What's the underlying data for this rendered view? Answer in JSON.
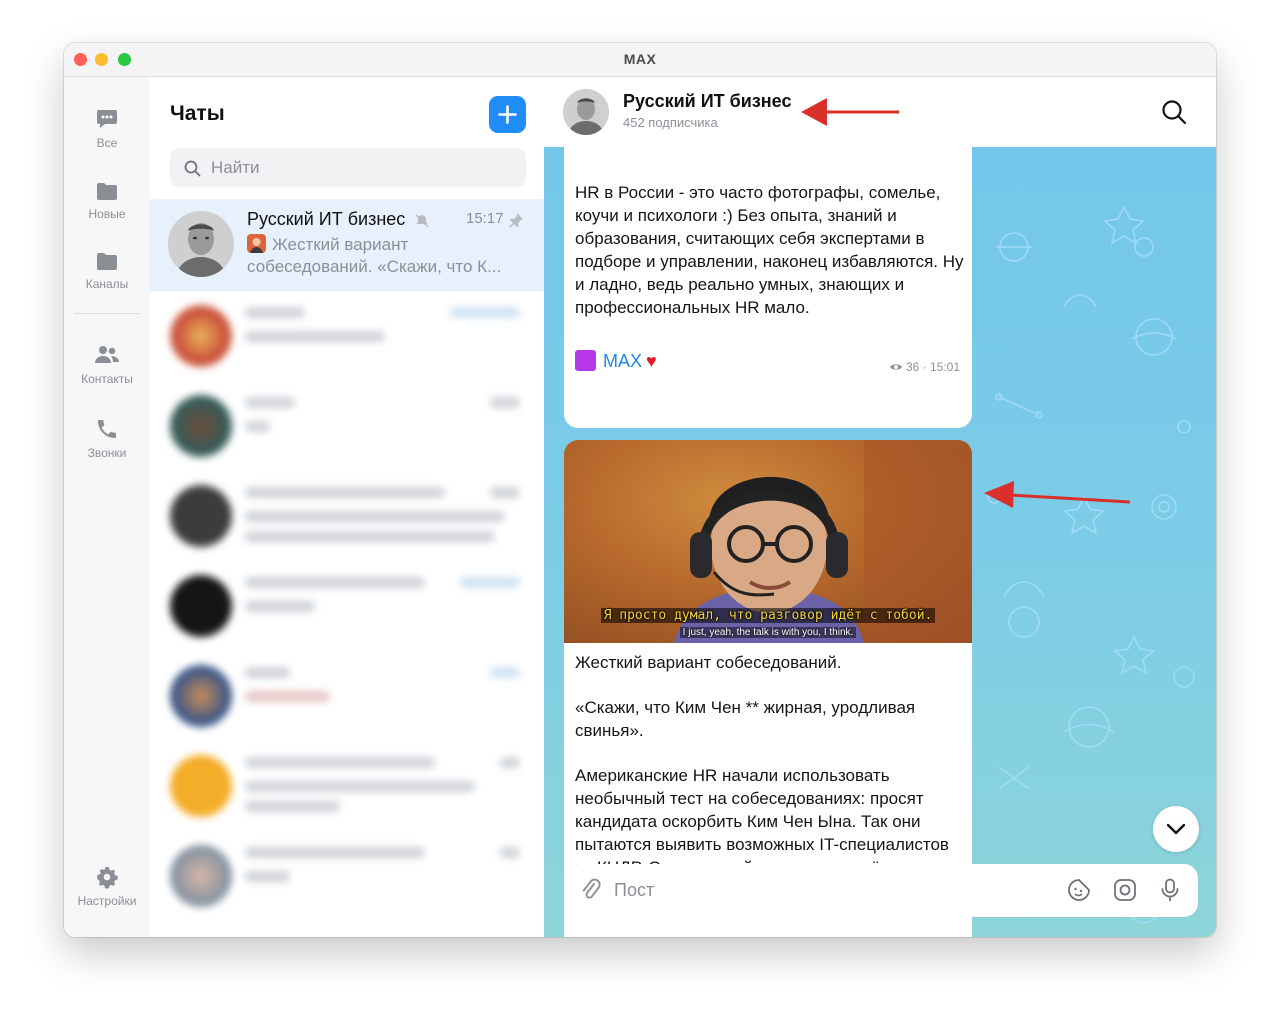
{
  "window": {
    "title": "MAX"
  },
  "rail": {
    "items": [
      {
        "label": "Все",
        "icon": "chat-bubble-icon"
      },
      {
        "label": "Новые",
        "icon": "folder-icon"
      },
      {
        "label": "Каналы",
        "icon": "folder-icon"
      },
      {
        "label": "Контакты",
        "icon": "people-icon"
      },
      {
        "label": "Звонки",
        "icon": "phone-icon"
      }
    ],
    "settings": {
      "label": "Настройки",
      "icon": "gear-icon"
    }
  },
  "chat_list": {
    "title": "Чаты",
    "new_chat_icon": "plus-icon",
    "search_placeholder": "Найти",
    "active_chat": {
      "name": "Русский ИТ бизнес",
      "time": "15:17",
      "preview_line1": "Жесткий вариант",
      "preview_line2": "собеседований.  «Скажи, что К..."
    }
  },
  "chat": {
    "header": {
      "name": "Русский ИТ бизнес",
      "subscribers": "452 подписчика"
    },
    "post1": {
      "text": "HR в России - это часто фотографы, сомелье, коучи и психологи :) Без опыта, знаний и образования, считающих себя экспертами в подборе и управлении, наконец избавляются. Ну и ладно, ведь реально умных, знающих и профессиональных HR мало.",
      "signature": "MAX",
      "views": "36",
      "time": "15:01"
    },
    "post2": {
      "video_subtitle_ru": "Я просто думал, что разговор идёт с тобой.",
      "video_subtitle_en": "I just, yeah, the talk is with you, I think.",
      "paragraph1": "Жесткий вариант собеседований.",
      "paragraph2": "«Скажи, что Ким Чен ** жирная, уродливая свинья».",
      "paragraph3": "Американские HR начали использовать необычный тест на собеседованиях: просят кандидата оскорбить Ким Чен Ына. Так они пытаются выявить возможных IT-специалистов из КНДР. Северокорейские хакеры всё чаще устраиваются в западные"
    },
    "composer": {
      "placeholder": "Пост"
    }
  },
  "colors": {
    "accent": "#1f8df5",
    "active_row": "#e6f1fc",
    "chat_background": "#72c6eb",
    "annotation_arrow": "#d9302b"
  }
}
